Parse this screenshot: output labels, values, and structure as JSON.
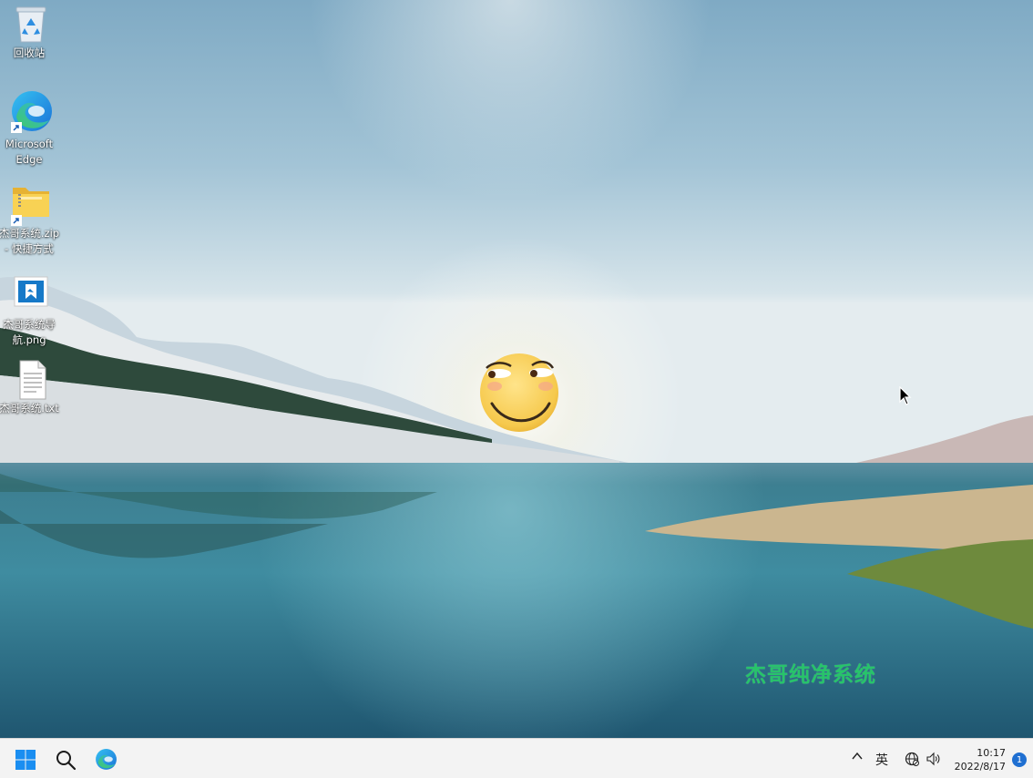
{
  "desktop": {
    "icons": [
      {
        "label": "回收站",
        "icon": "recycle-bin-icon"
      },
      {
        "label": "Microsoft\nEdge",
        "icon": "edge-icon",
        "shortcut": true
      },
      {
        "label": "杰哥系统.zip\n- 快捷方式",
        "icon": "zip-folder-icon",
        "shortcut": true
      },
      {
        "label": "杰哥系统导\n航.png",
        "icon": "image-file-icon"
      },
      {
        "label": "杰哥系统.txt",
        "icon": "text-file-icon"
      }
    ],
    "watermark": "杰哥纯净系统"
  },
  "taskbar": {
    "start": "start-icon",
    "search": "search-icon",
    "pinned": [
      "edge-icon"
    ],
    "tray": {
      "overflow": "^",
      "input_method": "英",
      "network": "network-icon",
      "volume": "volume-icon",
      "time": "10:17",
      "date": "2022/8/17",
      "notifications": "1"
    }
  },
  "colors": {
    "watermark": "#27c46a",
    "taskbar_bg": "#f3f3f3",
    "windows_blue": "#1f6fd1"
  }
}
